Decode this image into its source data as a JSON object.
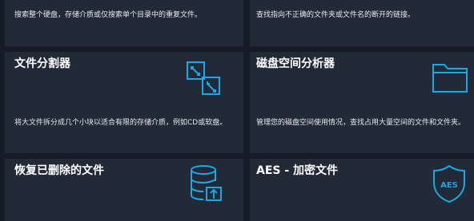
{
  "accent": "#1ea7e1",
  "cards": [
    {
      "title": "",
      "description": "搜索整个硬盘，存储介质或仅搜索单个目录中的重复文件。"
    },
    {
      "title": "",
      "description": "查找指向不正确的文件夹或文件名的断开的链接。"
    },
    {
      "title": "文件分割器",
      "description": "将大文件拆分成几个小块以适合有限的存储介质，例如CD或软盘。",
      "icon": "split-arrows-icon"
    },
    {
      "title": "磁盘空间分析器",
      "description": "管理您的磁盘空间使用情况，查找占用大量空间的文件和文件夹。",
      "icon": "folder-icon"
    },
    {
      "title": "恢复已删除的文件",
      "description": "",
      "icon": "database-restore-icon"
    },
    {
      "title": "AES - 加密文件",
      "description": "",
      "icon": "aes-shield-icon",
      "icon_text": "AES"
    }
  ]
}
